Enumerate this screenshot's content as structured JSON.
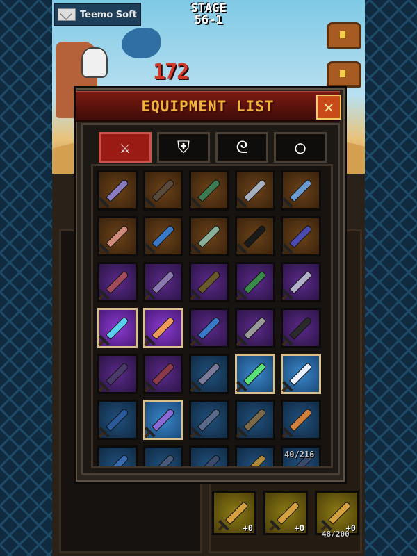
{
  "hud": {
    "mail_label": "Teemo Soft",
    "stage_label": "STAGE",
    "stage_number": "56-1",
    "damage_text": "172"
  },
  "dialog": {
    "title": "EQUIPMENT LIST",
    "close_label": "✕",
    "tabs": [
      {
        "icon": "sword-icon",
        "glyph": "⚔",
        "active": true
      },
      {
        "icon": "shield-icon",
        "glyph": "⛨",
        "active": false
      },
      {
        "icon": "necklace-icon",
        "glyph": "ᘓ",
        "active": false
      },
      {
        "icon": "ring-icon",
        "glyph": "◯",
        "active": false
      }
    ],
    "count": "40/216",
    "items": [
      {
        "tier": "brown",
        "color": "#8a7ac0"
      },
      {
        "tier": "brown",
        "color": "#5a4a3a"
      },
      {
        "tier": "brown",
        "color": "#3c7a52"
      },
      {
        "tier": "brown",
        "color": "#a8b0c0"
      },
      {
        "tier": "brown",
        "color": "#6a9ad0"
      },
      {
        "tier": "brown",
        "color": "#d08a7a"
      },
      {
        "tier": "brown",
        "color": "#3a78c8"
      },
      {
        "tier": "brown",
        "color": "#8ab09a"
      },
      {
        "tier": "brown",
        "color": "#1a1a1a"
      },
      {
        "tier": "brown",
        "color": "#4a4ab0"
      },
      {
        "tier": "purple",
        "color": "#a04a5a"
      },
      {
        "tier": "purple",
        "color": "#8a7ab0"
      },
      {
        "tier": "purple",
        "color": "#6a5a2a"
      },
      {
        "tier": "purple",
        "color": "#3a8a4a"
      },
      {
        "tier": "purple",
        "color": "#b0b0c8"
      },
      {
        "tier": "purple",
        "color": "#5ad0f0",
        "selected": true
      },
      {
        "tier": "purple",
        "color": "#f09a5a",
        "selected": true
      },
      {
        "tier": "purple",
        "color": "#3a78c8"
      },
      {
        "tier": "purple",
        "color": "#9a9a9a"
      },
      {
        "tier": "purple",
        "color": "#2a2a2a"
      },
      {
        "tier": "purple",
        "color": "#4a3a6a"
      },
      {
        "tier": "purple",
        "color": "#8a3a4a"
      },
      {
        "tier": "blue",
        "color": "#7a7a9a"
      },
      {
        "tier": "blue",
        "color": "#5ae07a",
        "selected": true
      },
      {
        "tier": "blue",
        "color": "#e8f0ff",
        "selected": true
      },
      {
        "tier": "blue",
        "color": "#2a5a9a"
      },
      {
        "tier": "blue",
        "color": "#8a6ad8",
        "selected": true
      },
      {
        "tier": "blue",
        "color": "#5a6a8a"
      },
      {
        "tier": "blue",
        "color": "#7a6a4a"
      },
      {
        "tier": "blue",
        "color": "#d0803a"
      },
      {
        "tier": "blue",
        "color": "#3a6ab0"
      },
      {
        "tier": "blue",
        "color": "#4a5a7a"
      },
      {
        "tier": "blue",
        "color": "#3a4a6a"
      },
      {
        "tier": "blue",
        "color": "#b08a3a"
      },
      {
        "tier": "blue",
        "color": "#3a4a6a"
      }
    ]
  },
  "inventory": {
    "items": [
      {
        "plus": "+0"
      },
      {
        "plus": "+0"
      },
      {
        "plus": "+0"
      }
    ],
    "count": "48/200"
  }
}
